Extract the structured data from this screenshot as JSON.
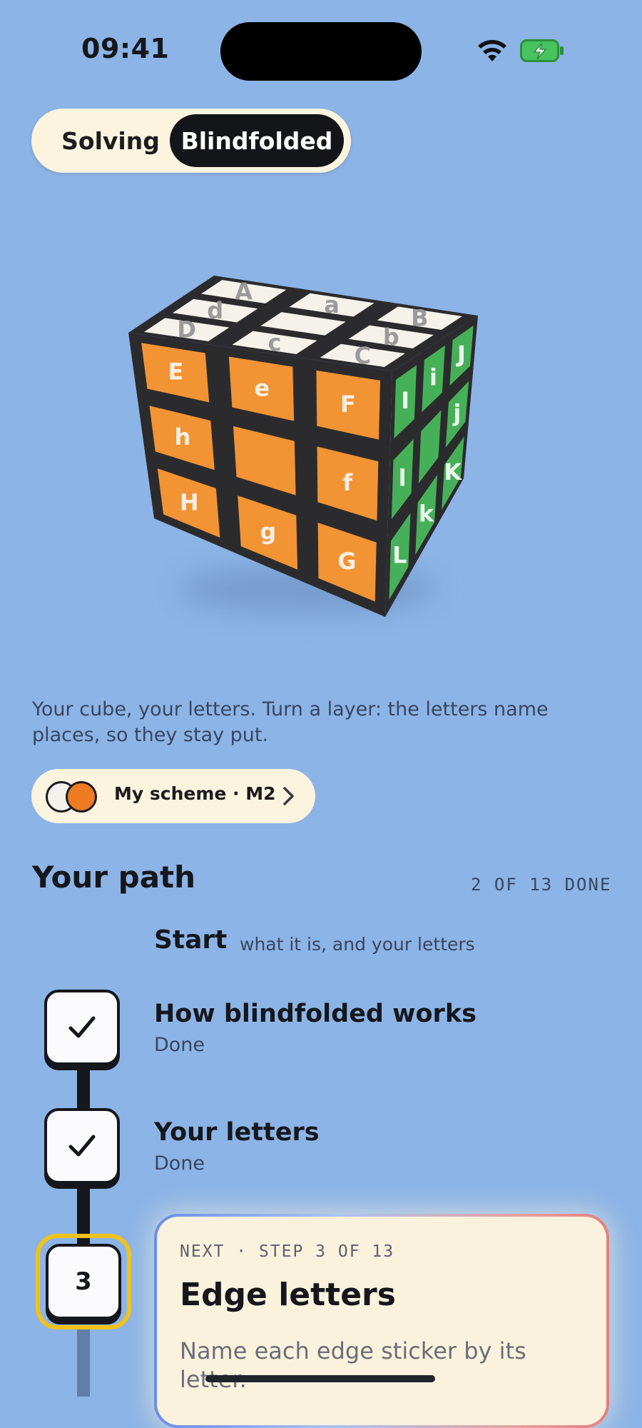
{
  "status_bar": {
    "time": "09:41"
  },
  "mode_switch": {
    "options": [
      "Solving",
      "Blindfolded"
    ],
    "selected": "Blindfolded"
  },
  "cube": {
    "top_letters": [
      "A",
      "a",
      "B",
      "d",
      "b",
      "D",
      "c",
      "C"
    ],
    "front_letters": [
      "E",
      "e",
      "F",
      "h",
      "f",
      "H",
      "g",
      "G"
    ],
    "right_letters": [
      "I",
      "i",
      "J",
      "l",
      "j",
      "L",
      "k",
      "K"
    ],
    "colors": {
      "top": "#f4f2ea",
      "front": "#f29334",
      "right": "#46b058",
      "frame": "#2b2b2e"
    }
  },
  "description": "Your cube, your letters. Turn a layer: the letters name places, so they stay put.",
  "scheme": {
    "label": "My scheme · M2"
  },
  "path": {
    "title": "Your path",
    "progress": "2 OF 13 DONE",
    "section": {
      "title": "Start",
      "subtitle": "what it is, and your letters"
    },
    "steps": [
      {
        "title": "How blindfolded works",
        "status": "Done"
      },
      {
        "title": "Your letters",
        "status": "Done"
      }
    ],
    "next": {
      "number": "3",
      "kicker": "NEXT · STEP 3 OF 13",
      "title": "Edge letters",
      "body": "Name each edge sticker by its letter."
    }
  },
  "icons": [
    "wifi-icon",
    "battery-charging-icon",
    "chevron-right-icon",
    "checkmark-icon"
  ],
  "theme": {
    "background": "#8cb4e6",
    "accent": "#f2c21a",
    "ink": "#15171c",
    "cream": "#fcf4df"
  }
}
